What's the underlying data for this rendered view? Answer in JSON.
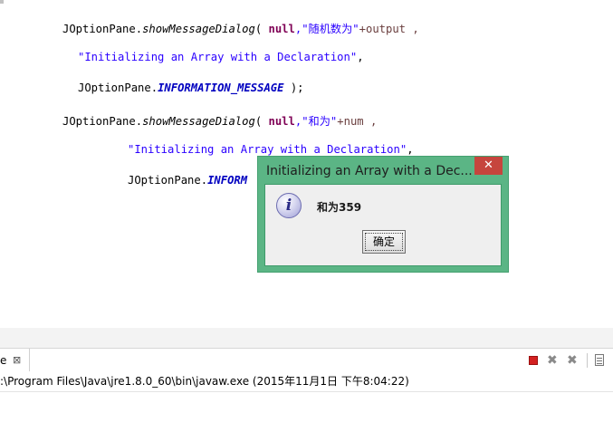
{
  "editor": {
    "lines": [
      {
        "t1": "JOptionPane.",
        "t2": "showMessageDialog",
        "t3": "( ",
        "t4": "null",
        "t5": ",\"",
        "t6": "随机数为",
        "t7": "\"",
        "t8": "+output ,"
      },
      {
        "str": "\"Initializing an Array with a Declaration\"",
        "tail": ","
      },
      {
        "t1": "JOptionPane.",
        "const": "INFORMATION_MESSAGE",
        "tail": " );"
      },
      {
        "t1": "JOptionPane.",
        "t2": "showMessageDialog",
        "t3": "( ",
        "t4": "null",
        "t5": ",\"",
        "t6": "和为",
        "t7": "\"",
        "t8": "+num ,"
      },
      {
        "str": "\"Initializing an Array with a Declaration\"",
        "tail": ","
      },
      {
        "t1": "JOptionPane.",
        "const": "INFORM"
      }
    ]
  },
  "dialog": {
    "title": "Initializing an Array with a Dec...",
    "close_glyph": "✕",
    "icon_glyph": "i",
    "message": "和为359",
    "ok_label": "确定"
  },
  "console": {
    "tab_label": "e",
    "tab_close_glyph": "⊠",
    "remove_glyph": "✖",
    "remove_all_glyph": "✖",
    "header": ":\\Program Files\\Java\\jre1.8.0_60\\bin\\javaw.exe (2015年11月1日 下午8:04:22)"
  },
  "colors": {
    "keyword": "#7f0055",
    "string": "#2a00ff",
    "constant": "#0000c0",
    "dialog_frame": "#5bb585",
    "dialog_close": "#c6453d"
  }
}
